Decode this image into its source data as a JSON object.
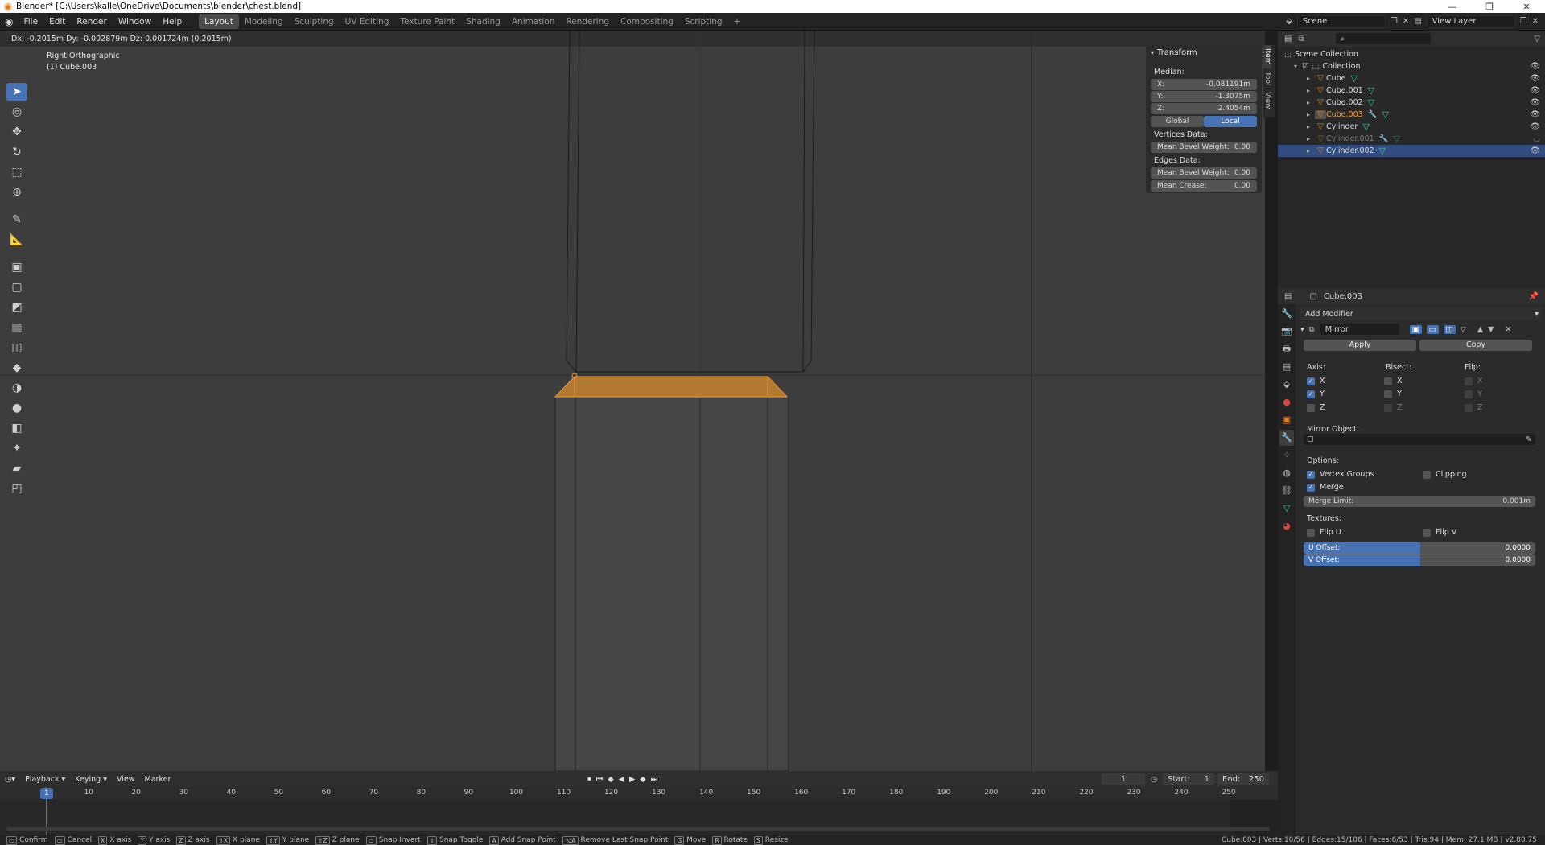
{
  "window": {
    "title": "Blender* [C:\\Users\\kalle\\OneDrive\\Documents\\blender\\chest.blend]"
  },
  "menus": [
    "File",
    "Edit",
    "Render",
    "Window",
    "Help"
  ],
  "workspaces": [
    "Layout",
    "Modeling",
    "Sculpting",
    "UV Editing",
    "Texture Paint",
    "Shading",
    "Animation",
    "Rendering",
    "Compositing",
    "Scripting",
    "+"
  ],
  "active_workspace": "Layout",
  "scene": {
    "label": "Scene",
    "view_layer": "View Layer"
  },
  "viewport": {
    "header_text": "Dx: -0.2015m  Dy: -0.002879m  Dz: 0.001724m (0.2015m)",
    "view_name": "Right Orthographic",
    "object_name": "(1) Cube.003",
    "edge_color": "#e0902e",
    "face_color": "#b37a34"
  },
  "npanel": {
    "title": "Transform",
    "median_label": "Median:",
    "x_label": "X:",
    "x_value": "-0.081191m",
    "y_label": "Y:",
    "y_value": "-1.3075m",
    "z_label": "Z:",
    "z_value": "2.4054m",
    "global": "Global",
    "local": "Local",
    "vertices_data": "Vertices Data:",
    "mean_bevel_label": "Mean Bevel Weight:",
    "mean_bevel_value": "0.00",
    "edges_data": "Edges Data:",
    "edge_bevel_label": "Mean Bevel Weight:",
    "edge_bevel_value": "0.00",
    "crease_label": "Mean Crease:",
    "crease_value": "0.00",
    "tabs": [
      "Item",
      "Tool",
      "View"
    ]
  },
  "outliner": {
    "scene_collection": "Scene Collection",
    "collection": "Collection",
    "items": [
      "Cube",
      "Cube.001",
      "Cube.002",
      "Cube.003",
      "Cylinder",
      "Cylinder.001",
      "Cylinder.002"
    ]
  },
  "properties": {
    "object": "Cube.003",
    "add_modifier": "Add Modifier",
    "modifier_name": "Mirror",
    "apply": "Apply",
    "copy": "Copy",
    "axis": "Axis:",
    "bisect": "Bisect:",
    "flip": "Flip:",
    "x": "X",
    "y": "Y",
    "z": "Z",
    "mirror_object": "Mirror Object:",
    "options": "Options:",
    "vertex_groups": "Vertex Groups",
    "clipping": "Clipping",
    "merge": "Merge",
    "merge_limit_label": "Merge Limit:",
    "merge_limit_value": "0.001m",
    "textures": "Textures:",
    "flip_u": "Flip U",
    "flip_v": "Flip V",
    "u_offset_label": "U Offset:",
    "u_offset_value": "0.0000",
    "v_offset_label": "V Offset:",
    "v_offset_value": "0.0000"
  },
  "timeline": {
    "playback": "Playback",
    "keying": "Keying",
    "view": "View",
    "marker": "Marker",
    "current_frame": "1",
    "start_label": "Start:",
    "start_value": "1",
    "end_label": "End:",
    "end_value": "250",
    "ticks": [
      "1",
      "10",
      "20",
      "30",
      "40",
      "50",
      "60",
      "70",
      "80",
      "90",
      "100",
      "110",
      "120",
      "130",
      "140",
      "150",
      "160",
      "170",
      "180",
      "190",
      "200",
      "210",
      "220",
      "230",
      "240",
      "250"
    ]
  },
  "statusbar": {
    "items": [
      "Confirm",
      "Cancel",
      "X axis",
      "Y axis",
      "Z axis",
      "X plane",
      "Y plane",
      "Z plane",
      "Snap Invert",
      "Snap Toggle",
      "Add Snap Point",
      "Remove Last Snap Point",
      "Move",
      "Rotate",
      "Resize"
    ],
    "keys": [
      "",
      "",
      "X",
      "Y",
      "Z",
      "⇧X",
      "⇧Y",
      "⇧Z",
      "",
      "⇧",
      "A",
      "⌥A",
      "G",
      "R",
      "S"
    ],
    "stats": "Cube.003 | Verts:10/56 | Edges:15/106 | Faces:6/53 | Tris:94 | Mem: 27.1 MB | v2.80.75"
  }
}
